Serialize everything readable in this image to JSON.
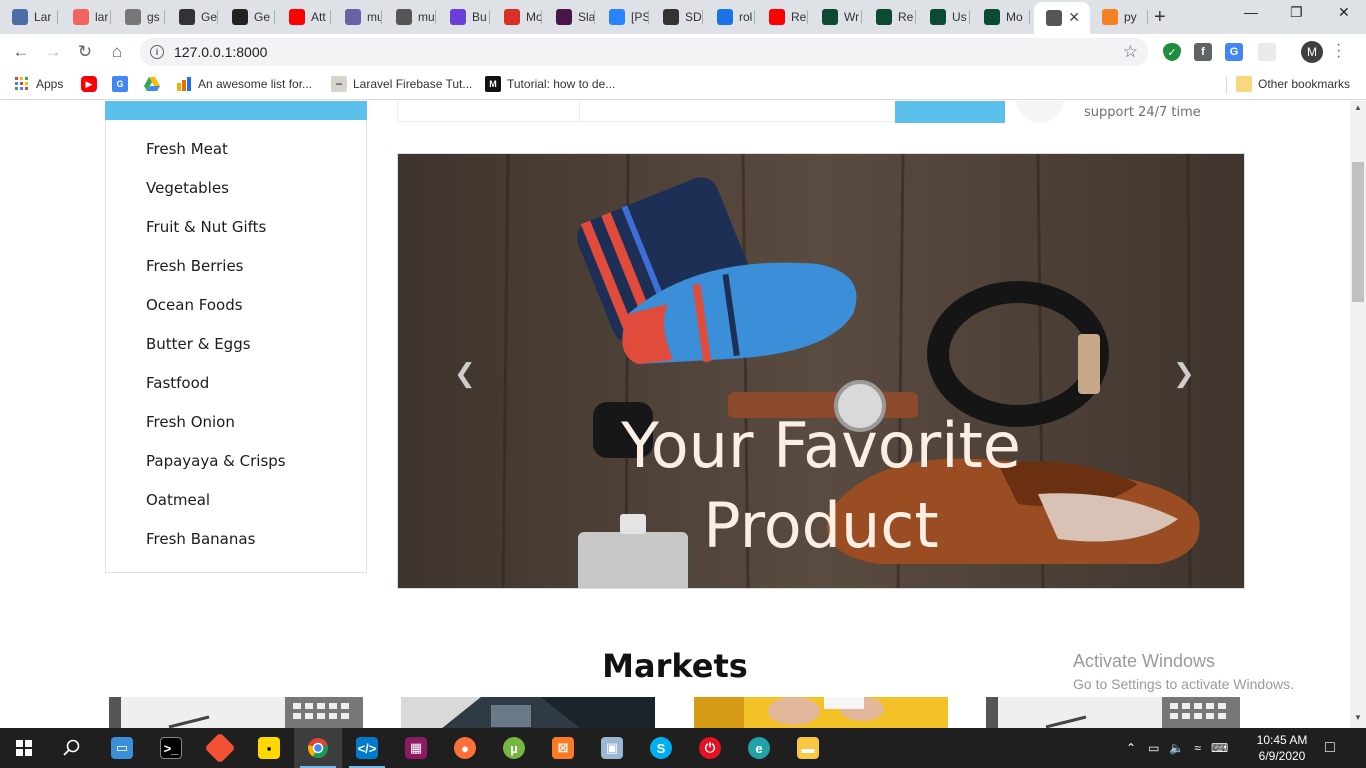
{
  "browser": {
    "tabs": [
      {
        "title": "Lar",
        "icon": "send-icon",
        "color": "#4a6fa5"
      },
      {
        "title": "lar",
        "icon": "laravel-icon",
        "color": "#f4645f"
      },
      {
        "title": "gs",
        "icon": "code-icon",
        "color": "#777777"
      },
      {
        "title": "Ge",
        "icon": "save-icon",
        "color": "#333333"
      },
      {
        "title": "Ge",
        "icon": "github-icon",
        "color": "#222222"
      },
      {
        "title": "Att",
        "icon": "youtube-icon",
        "color": "#ff0000"
      },
      {
        "title": "mu",
        "icon": "heroku-icon",
        "color": "#6762a6"
      },
      {
        "title": "mu",
        "icon": "globe-icon",
        "color": "#555555"
      },
      {
        "title": "Bu",
        "icon": "butterfly-icon",
        "color": "#6a3fd8"
      },
      {
        "title": "Mo",
        "icon": "gmail-icon",
        "color": "#d93025"
      },
      {
        "title": "Sla",
        "icon": "slack-icon",
        "color": "#4a154b"
      },
      {
        "title": "[PS",
        "icon": "jira-icon",
        "color": "#2684ff"
      },
      {
        "title": "SD",
        "icon": "diamond-icon",
        "color": "#333333"
      },
      {
        "title": "rol",
        "icon": "shield-icon",
        "color": "#1a73e8"
      },
      {
        "title": "Re",
        "icon": "youtube-icon",
        "color": "#ff0000"
      },
      {
        "title": "Wr",
        "icon": "django-icon",
        "color": "#0c4b33"
      },
      {
        "title": "Re",
        "icon": "django-icon",
        "color": "#0c4b33"
      },
      {
        "title": "Us",
        "icon": "django-icon",
        "color": "#0c4b33"
      },
      {
        "title": "Mo",
        "icon": "django-icon",
        "color": "#0c4b33"
      },
      {
        "title": "",
        "icon": "globe-icon",
        "color": "#555555",
        "active": true
      },
      {
        "title": "py",
        "icon": "stackoverflow-icon",
        "color": "#f48024"
      }
    ],
    "url": "127.0.0.1:8000",
    "profile_initial": "M",
    "bookmarks": [
      {
        "label": "Apps",
        "icon": "apps-grid-icon"
      },
      {
        "label": "",
        "icon": "youtube-icon"
      },
      {
        "label": "",
        "icon": "google-translate-icon"
      },
      {
        "label": "",
        "icon": "google-drive-icon"
      },
      {
        "label": "An awesome list for...",
        "icon": "analytics-icon"
      },
      {
        "label": "Laravel Firebase Tut...",
        "icon": "site-icon"
      },
      {
        "label": "Tutorial: how to de...",
        "icon": "medium-icon"
      }
    ],
    "other_bookmarks": "Other bookmarks"
  },
  "page": {
    "departments": [
      "Fresh Meat",
      "Vegetables",
      "Fruit & Nut Gifts",
      "Fresh Berries",
      "Ocean Foods",
      "Butter & Eggs",
      "Fastfood",
      "Fresh Onion",
      "Papayaya & Crisps",
      "Oatmeal",
      "Fresh Bananas"
    ],
    "support_text": "support 24/7 time",
    "hero_caption_line1": "Your Favorite",
    "hero_caption_line2": "Product",
    "markets_title": "Markets",
    "accent_color": "#5bc0eb"
  },
  "watermark": {
    "line1": "Activate Windows",
    "line2": "Go to Settings to activate Windows."
  },
  "taskbar": {
    "time": "10:45 AM",
    "date": "6/9/2020"
  }
}
